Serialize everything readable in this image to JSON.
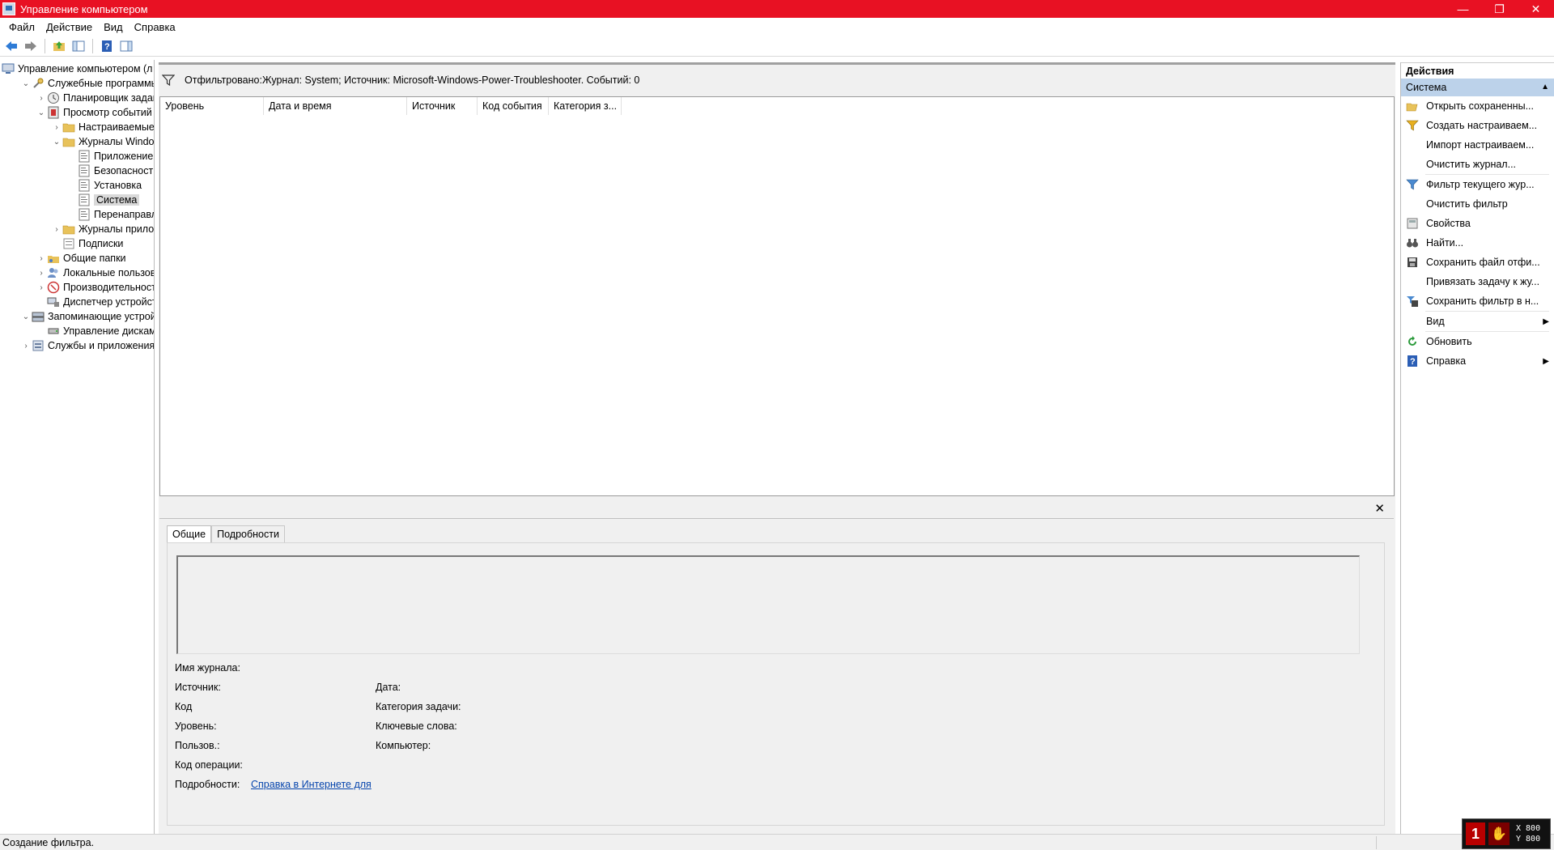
{
  "window": {
    "title": "Управление компьютером",
    "buttons": [
      "—",
      "❐",
      "✕"
    ]
  },
  "menu": [
    "Файл",
    "Действие",
    "Вид",
    "Справка"
  ],
  "toolbar": {
    "icons": [
      "back-arrow-icon",
      "forward-arrow-icon",
      "up-folder-icon",
      "show-hide-tree-icon",
      "help-icon",
      "properties-pane-icon"
    ]
  },
  "tree": {
    "items": [
      {
        "label": "Управление компьютером (л",
        "level": 0,
        "chevron": "",
        "icon": "computer-management-icon"
      },
      {
        "label": "Служебные программы",
        "level": 1,
        "chevron": "v",
        "icon": "tools-icon"
      },
      {
        "label": "Планировщик заданий",
        "level": 2,
        "chevron": ">",
        "icon": "clock-icon"
      },
      {
        "label": "Просмотр событий",
        "level": 2,
        "chevron": "v",
        "icon": "event-viewer-icon"
      },
      {
        "label": "Настраиваемые пр",
        "level": 3,
        "chevron": ">",
        "icon": "folder-icon"
      },
      {
        "label": "Журналы Windows",
        "level": 3,
        "chevron": "v",
        "icon": "folder-icon"
      },
      {
        "label": "Приложение",
        "level": 4,
        "chevron": "",
        "icon": "log-icon"
      },
      {
        "label": "Безопасность",
        "level": 4,
        "chevron": "",
        "icon": "log-icon"
      },
      {
        "label": "Установка",
        "level": 4,
        "chevron": "",
        "icon": "log-icon"
      },
      {
        "label": "Система",
        "level": 4,
        "chevron": "",
        "icon": "log-icon",
        "selected": true
      },
      {
        "label": "Перенаправлен",
        "level": 4,
        "chevron": "",
        "icon": "log-icon"
      },
      {
        "label": "Журналы приложе",
        "level": 3,
        "chevron": ">",
        "icon": "folder-icon"
      },
      {
        "label": "Подписки",
        "level": 3,
        "chevron": "",
        "icon": "subscriptions-icon"
      },
      {
        "label": "Общие папки",
        "level": 2,
        "chevron": ">",
        "icon": "shared-folders-icon"
      },
      {
        "label": "Локальные пользовате",
        "level": 2,
        "chevron": ">",
        "icon": "users-icon"
      },
      {
        "label": "Производительность",
        "level": 2,
        "chevron": ">",
        "icon": "performance-icon"
      },
      {
        "label": "Диспетчер устройств",
        "level": 2,
        "chevron": "",
        "icon": "device-manager-icon"
      },
      {
        "label": "Запоминающие устройст",
        "level": 1,
        "chevron": "v",
        "icon": "storage-icon"
      },
      {
        "label": "Управление дисками",
        "level": 2,
        "chevron": "",
        "icon": "disk-icon"
      },
      {
        "label": "Службы и приложения",
        "level": 1,
        "chevron": ">",
        "icon": "services-icon"
      }
    ]
  },
  "center": {
    "filter_text": "Отфильтровано:Журнал: System; Источник: Microsoft-Windows-Power-Troubleshooter. Событий: 0",
    "columns": [
      "Уровень",
      "Дата и время",
      "Источник",
      "Код события",
      "Категория з..."
    ],
    "details": {
      "tabs": [
        "Общие",
        "Подробности"
      ],
      "fields": {
        "log_name": "Имя журнала:",
        "source": "Источник:",
        "code": "Код",
        "level": "Уровень:",
        "user": "Пользов.:",
        "opcode": "Код операции:",
        "more": "Подробности:",
        "more_link": "Справка в Интернете для",
        "date": "Дата:",
        "task_category": "Категория задачи:",
        "keywords": "Ключевые слова:",
        "computer": "Компьютер:"
      }
    }
  },
  "actions": {
    "header": "Действия",
    "section": "Система",
    "items": [
      {
        "label": "Открыть сохраненны...",
        "icon": "open-folder-icon",
        "arrow": false
      },
      {
        "label": "Создать настраиваем...",
        "icon": "filter-create-icon",
        "arrow": false
      },
      {
        "label": "Импорт настраиваем...",
        "icon": "",
        "arrow": false
      },
      {
        "label": "Очистить журнал...",
        "icon": "",
        "arrow": false
      },
      {
        "label": "Фильтр текущего жур...",
        "icon": "filter-icon",
        "arrow": false
      },
      {
        "label": "Очистить фильтр",
        "icon": "",
        "arrow": false
      },
      {
        "label": "Свойства",
        "icon": "properties-icon",
        "arrow": false
      },
      {
        "label": "Найти...",
        "icon": "binoculars-icon",
        "arrow": false
      },
      {
        "label": "Сохранить файл отфи...",
        "icon": "save-icon",
        "arrow": false
      },
      {
        "label": "Привязать задачу к жу...",
        "icon": "",
        "arrow": false
      },
      {
        "label": "Сохранить фильтр в н...",
        "icon": "save-filter-icon",
        "arrow": false
      },
      {
        "label": "Вид",
        "icon": "",
        "arrow": true
      },
      {
        "label": "Обновить",
        "icon": "refresh-icon",
        "arrow": false
      },
      {
        "label": "Справка",
        "icon": "help-icon",
        "arrow": true
      }
    ]
  },
  "status": {
    "text": "Создание фильтра."
  },
  "overlay": {
    "badge": "1",
    "x": "X 800",
    "y": "Y 800"
  }
}
